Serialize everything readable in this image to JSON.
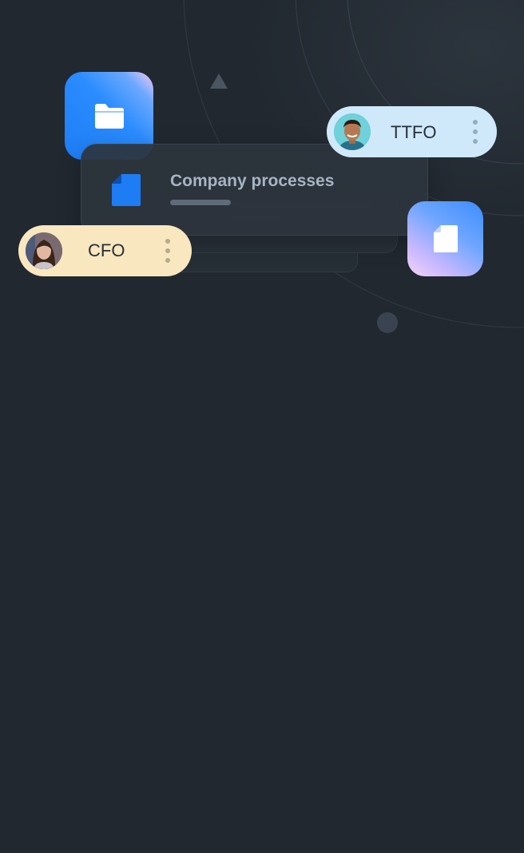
{
  "card": {
    "title": "Company processes",
    "progress": 0.35
  },
  "pills": {
    "ttfo": {
      "label": "TTFO",
      "color": "#cfe9fb"
    },
    "cfo": {
      "label": "CFO",
      "color": "#f8e7bf"
    }
  },
  "icons": {
    "folder_tile": "folder-icon",
    "doc_tile": "document-icon",
    "card_icon": "document-icon",
    "more": "more-vertical-icon"
  },
  "colors": {
    "background": "#212830",
    "accent_blue": "#1e7df5"
  }
}
